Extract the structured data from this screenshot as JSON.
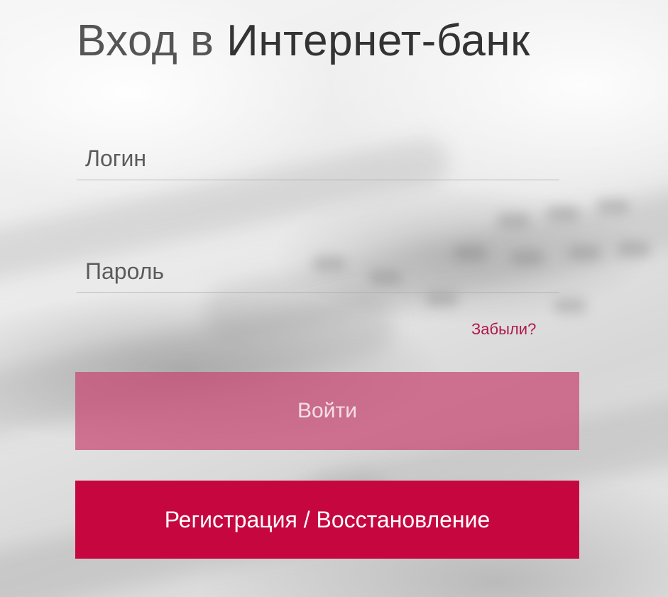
{
  "title": {
    "part_a": "Вход в",
    "part_b": "Интернет-банк"
  },
  "form": {
    "login_placeholder": "Логин",
    "password_placeholder": "Пароль",
    "forgot_label": "Забыли?",
    "login_button_label": "Войти",
    "register_button_label": "Регистрация / Восстановление"
  },
  "colors": {
    "accent": "#c6073f",
    "login_button_disabled": "#c84673",
    "forgot_link": "#b0184a"
  }
}
